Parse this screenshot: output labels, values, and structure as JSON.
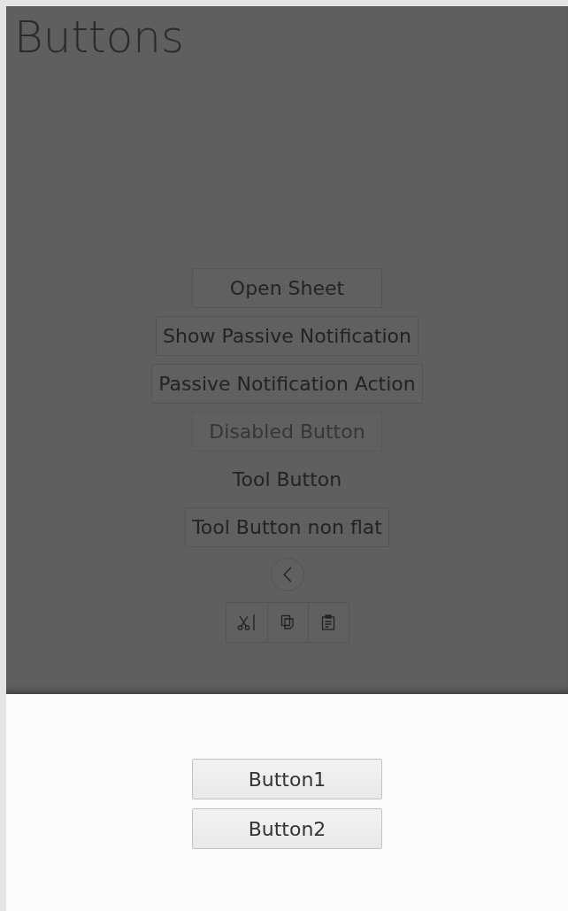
{
  "page": {
    "title": "Buttons"
  },
  "buttons": [
    {
      "kind": "push",
      "label": "Open Sheet",
      "disabled": false
    },
    {
      "kind": "push",
      "label": "Show Passive Notification",
      "disabled": false
    },
    {
      "kind": "push",
      "label": "Passive Notification Action",
      "disabled": false
    },
    {
      "kind": "push",
      "label": "Disabled Button",
      "disabled": true
    },
    {
      "kind": "flat",
      "label": "Tool Button"
    },
    {
      "kind": "push",
      "label": "Tool Button non flat",
      "disabled": false
    },
    {
      "kind": "round"
    },
    {
      "kind": "group",
      "icons": [
        {
          "kind": "cut"
        },
        {
          "kind": "copy"
        },
        {
          "kind": "paste"
        }
      ]
    }
  ],
  "sheet": {
    "buttons": [
      {
        "label": "Button1"
      },
      {
        "label": "Button2"
      }
    ]
  }
}
